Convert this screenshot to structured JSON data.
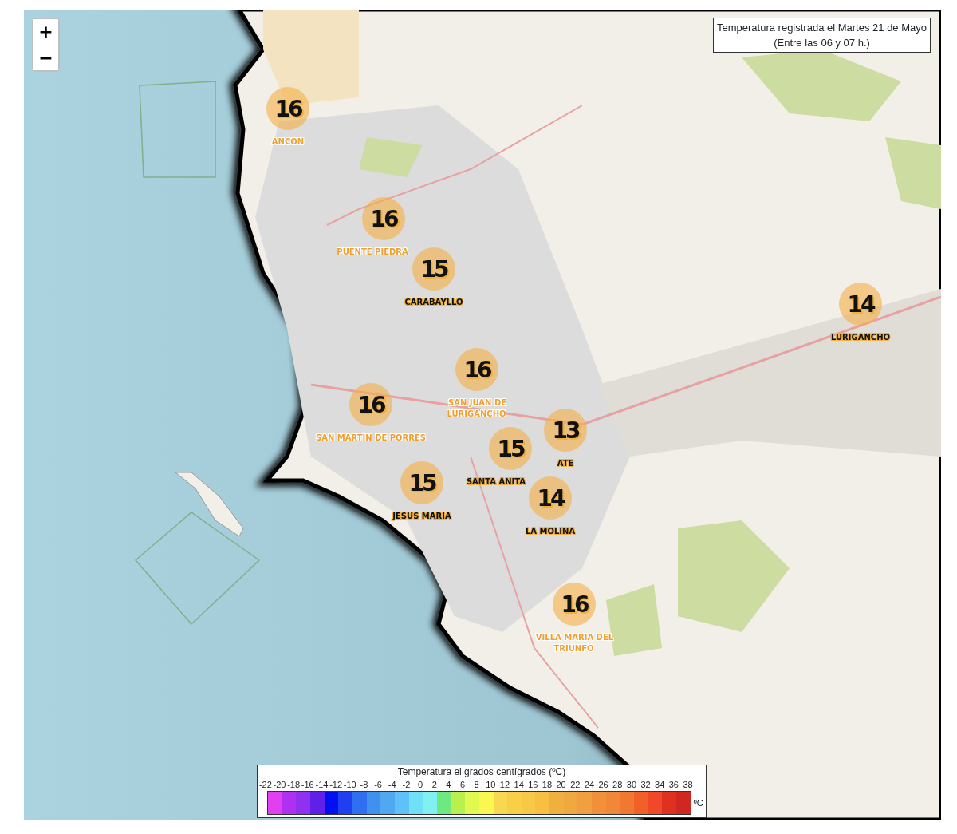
{
  "zoom_controls": [
    "+",
    "−"
  ],
  "title": {
    "line_1": "Temperatura registrada el Martes 21 de Mayo",
    "line_2": "(Entre las 06 y 07 h.)"
  },
  "stations": [
    {
      "value": "16",
      "name": "ANCON",
      "kind": "light"
    },
    {
      "value": "16",
      "name": "PUENTE PIEDRA",
      "kind": "light"
    },
    {
      "value": "15",
      "name": "CARABAYLLO",
      "kind": "dark"
    },
    {
      "value": "14",
      "name": "LURIGANCHO",
      "kind": "dark"
    },
    {
      "value": "16",
      "name": "SAN JUAN DE LURIGANCHO",
      "kind": "light"
    },
    {
      "value": "16",
      "name": "SAN MARTIN DE PORRES",
      "kind": "light"
    },
    {
      "value": "13",
      "name": "ATE",
      "kind": "dark"
    },
    {
      "value": "15",
      "name": "SANTA ANITA",
      "kind": "dark"
    },
    {
      "value": "15",
      "name": "JESUS MARIA",
      "kind": "dark"
    },
    {
      "value": "14",
      "name": "LA MOLINA",
      "kind": "dark"
    },
    {
      "value": "16",
      "name": "VILLA MARIA DEL TRIUNFO",
      "kind": "light"
    }
  ],
  "legend": {
    "title": "Temperatura el grados centígrados (ºC)",
    "unit": "ºC",
    "ticks": [
      "-22",
      "-20",
      "-18",
      "-16",
      "-14",
      "-12",
      "-10",
      "-8",
      "-6",
      "-4",
      "-2",
      "0",
      "2",
      "4",
      "6",
      "8",
      "10",
      "12",
      "14",
      "16",
      "18",
      "20",
      "22",
      "24",
      "26",
      "28",
      "30",
      "32",
      "34",
      "36",
      "38"
    ],
    "swatches": [
      {
        "color": "#e040f0"
      },
      {
        "color": "#b030f0"
      },
      {
        "color": "#9030f0"
      },
      {
        "color": "#6020e8"
      },
      {
        "color": "#0010f0"
      },
      {
        "color": "#2040f0"
      },
      {
        "color": "#3070f0"
      },
      {
        "color": "#4090f0"
      },
      {
        "color": "#50a8f0"
      },
      {
        "color": "#60c0f8"
      },
      {
        "color": "#70e0f8"
      },
      {
        "color": "#80f0f0"
      },
      {
        "color": "#70e880"
      },
      {
        "color": "#b8f050"
      },
      {
        "color": "#e0f850"
      },
      {
        "color": "#f8f850"
      },
      {
        "color": "#f8d850"
      },
      {
        "color": "#f8d048"
      },
      {
        "color": "#f8c848"
      },
      {
        "color": "#f8c040"
      },
      {
        "color": "#f0b040"
      },
      {
        "color": "#f0a840"
      },
      {
        "color": "#f0a040"
      },
      {
        "color": "#f09038"
      },
      {
        "color": "#f08838"
      },
      {
        "color": "#f07830"
      },
      {
        "color": "#f06028"
      },
      {
        "color": "#f04828"
      },
      {
        "color": "#e03020"
      },
      {
        "color": "#d02820"
      }
    ]
  }
}
